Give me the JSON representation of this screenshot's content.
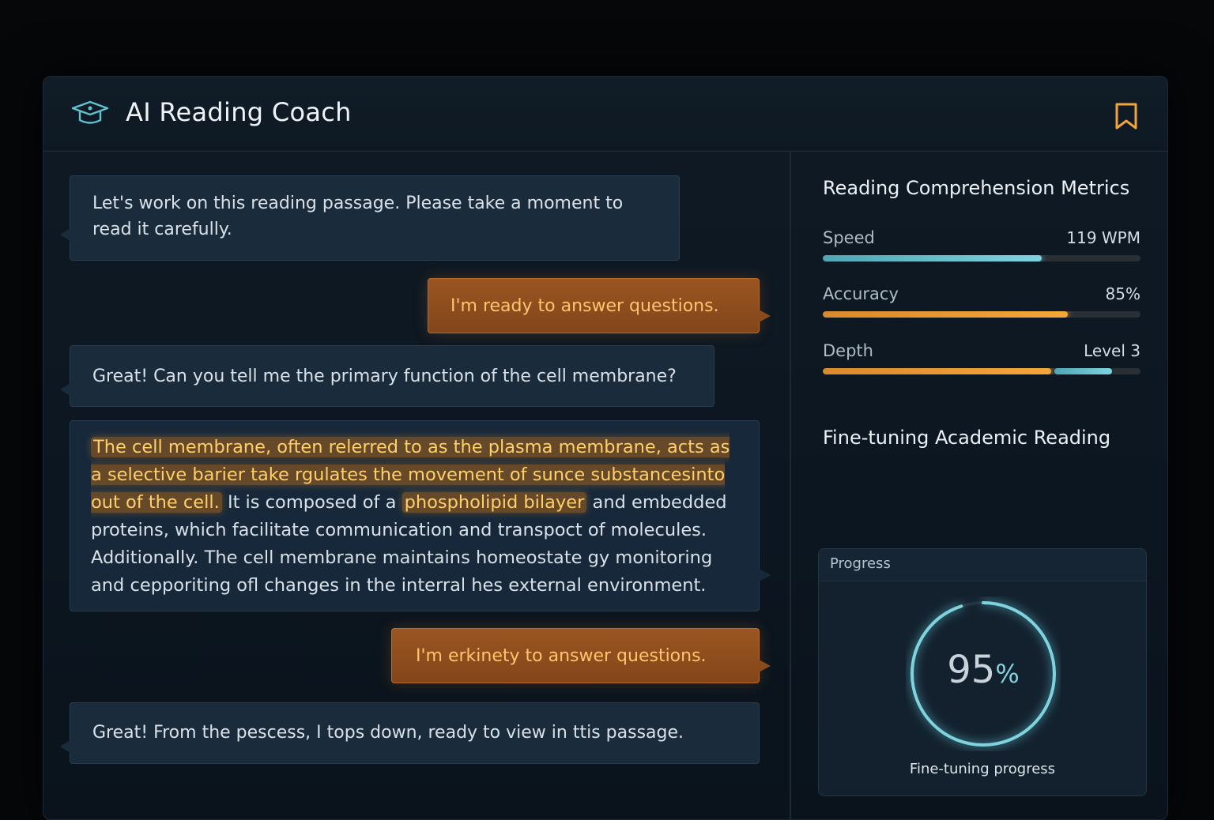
{
  "app": {
    "title": "AI Reading Coach",
    "logo_icon": "graduation-cap-icon",
    "bookmark_icon": "bookmark-icon"
  },
  "chat": {
    "messages": [
      {
        "role": "coach",
        "text": "Let's work on this reading passage. Please take a moment to read it carefully."
      },
      {
        "role": "user",
        "text": "I'm ready to answer questions."
      },
      {
        "role": "coach",
        "text": "Great! Can you tell me the primary function of the cell membrane?"
      },
      {
        "role": "passage",
        "segments": [
          {
            "text": "The cell membrane, often relerred to as the plasma membrane, acts as a selective barier take rgulates the movement of sunce substancesinto out of the cell.",
            "highlight": true
          },
          {
            "text": " It is composed of a ",
            "highlight": false
          },
          {
            "text": "phospholipid bilayer",
            "highlight": true
          },
          {
            "text": " and embedded proteins, which facilitate communication and transpoct of molecules. Additionally. The cell membrane maintains homeostate gy monitoring and cepporiting ofl changes in the interral hes external environment.",
            "highlight": false
          }
        ]
      },
      {
        "role": "user",
        "text": "I'm erkinety to answer questions."
      },
      {
        "role": "coach",
        "text": "Great! From the pescess, I tops down, ready to view in ttis passage."
      }
    ]
  },
  "metrics": {
    "title": "Reading Comprehension Metrics",
    "items": [
      {
        "label": "Speed",
        "value": "119 WPM",
        "level": 0.69,
        "color": "#6cc3cf"
      },
      {
        "label": "Accuracy",
        "value": "85%",
        "level": 0.77,
        "color": "#f0a237"
      },
      {
        "label": "Depth",
        "value": "Level 3",
        "level": 0.72,
        "secondary": 0.18,
        "color": "#e3922f"
      }
    ]
  },
  "finetune": {
    "title": "Fine-tuning Academic Reading",
    "card_header": "Progress",
    "percent_number": "95",
    "percent_sign": "%",
    "progress": 0.95,
    "caption": "Fine-tuning progress",
    "ring_color": "#7fd3df"
  }
}
